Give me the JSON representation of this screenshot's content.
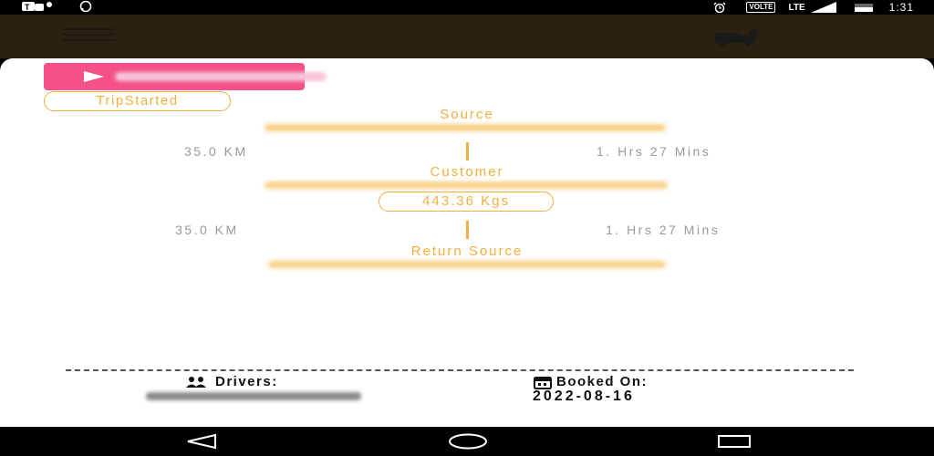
{
  "status_bar": {
    "time": "1:31",
    "volte": "VOLTE",
    "network": "LTE",
    "icons_left": [
      "teams-icon",
      "whatsapp-icon"
    ],
    "icons_right": [
      "alarm-icon",
      "volte-badge",
      "lte-signal-icon",
      "battery-icon"
    ]
  },
  "app_bar": {
    "title": "",
    "menu_icon": "hamburger-icon",
    "action_icon": "truck-icon"
  },
  "trip": {
    "start_button_icon": "play-icon",
    "status": "TripStarted",
    "source_label": "Source",
    "customer_label": "Customer",
    "return_label": "Return Source",
    "leg1": {
      "distance": "35.0 KM",
      "duration": "1. Hrs 27 Mins"
    },
    "leg2": {
      "distance": "35.0 KM",
      "duration": "1. Hrs 27 Mins"
    },
    "weight": "443.36 Kgs"
  },
  "footer": {
    "drivers_label": "Drivers:",
    "booked_label": "Booked On:",
    "booked_date": "2022-08-16"
  },
  "colors": {
    "accent": "#f0b040",
    "button": "#f5508a",
    "appbar": "#2b2110"
  }
}
